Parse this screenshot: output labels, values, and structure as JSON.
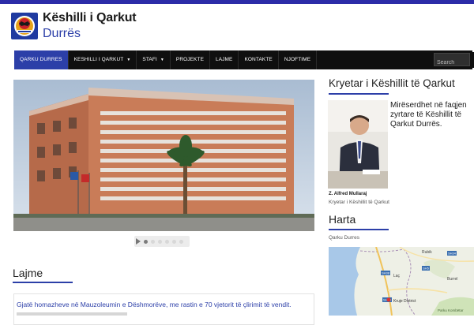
{
  "header": {
    "site_name": "Këshilli i Qarkut",
    "site_sub": "Durrës"
  },
  "nav": {
    "items": [
      {
        "label": "QARKU DURRES",
        "active": true,
        "dropdown": false
      },
      {
        "label": "KESHILLI I QARKUT",
        "active": false,
        "dropdown": true
      },
      {
        "label": "STAFI",
        "active": false,
        "dropdown": true
      },
      {
        "label": "PROJEKTE",
        "active": false,
        "dropdown": false
      },
      {
        "label": "LAJME",
        "active": false,
        "dropdown": false
      },
      {
        "label": "KONTAKTE",
        "active": false,
        "dropdown": false
      },
      {
        "label": "NJOFTIME",
        "active": false,
        "dropdown": false
      }
    ],
    "search_placeholder": "Search",
    "search_icon": "search-icon"
  },
  "slider": {
    "slide_count": 6,
    "active_index": 0,
    "play_icon": "play-icon"
  },
  "lajme": {
    "title": "Lajme",
    "first_news": "Gjatë homazheve në Mauzoleumin e Dëshmorëve, me rastin e 70 vjetorit të çlirimit të vendit."
  },
  "kryetar": {
    "title": "Kryetar i Këshillit të Qarkut",
    "welcome": "Mirëserdhet në faqjen zyrtare të Këshillit të Qarkut Durrës.",
    "name": "Z. Alfred Mullaraj",
    "role": "Kryetar i Këshillit të Qarkut"
  },
  "harta": {
    "title": "Harta",
    "label": "Qarku Durres",
    "places": [
      "Rubik",
      "Laç",
      "Burrel",
      "Kruje District",
      "Parku Kombëtar"
    ],
    "roads": [
      "SH34",
      "SH38",
      "SH39",
      "SH5"
    ]
  },
  "colors": {
    "accent": "#2c3fa8",
    "nav_bg": "#0f0f0f",
    "topbar": "#2c2ca8"
  }
}
